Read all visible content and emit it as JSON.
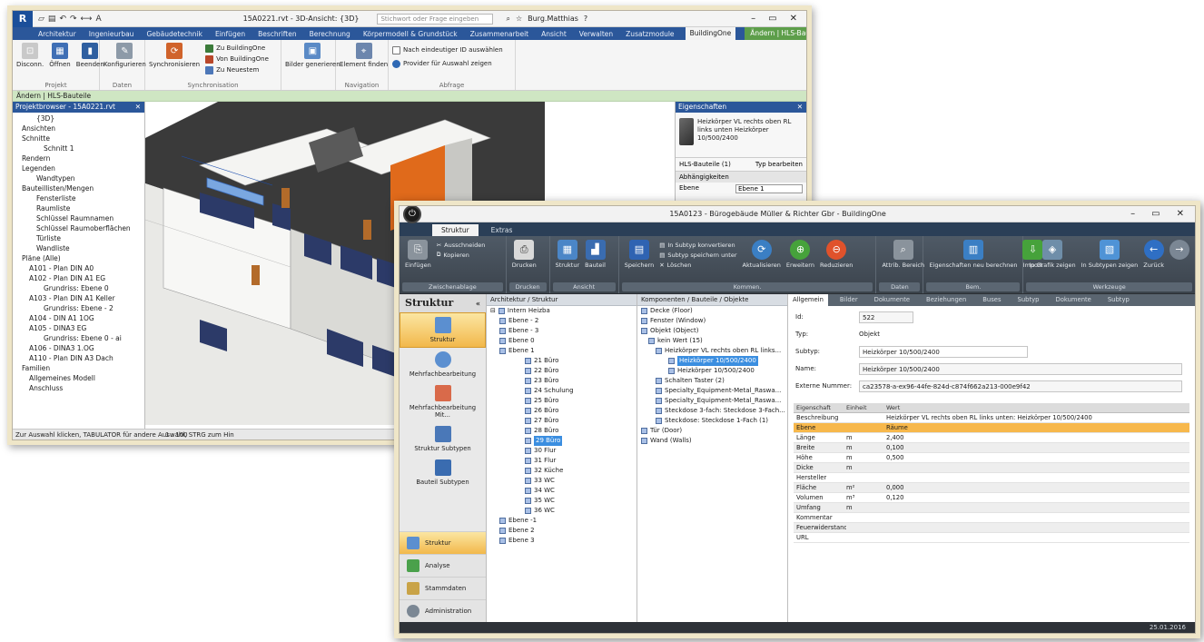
{
  "revit": {
    "title_logo": "R",
    "doc_title": "15A0221.rvt - 3D-Ansicht: {3D}",
    "search_placeholder": "Stichwort oder Frage eingeben",
    "user": "Burg.Matthias",
    "tabs": [
      "Architektur",
      "Ingenieurbau",
      "Gebäudetechnik",
      "Einfügen",
      "Beschriften",
      "Berechnung",
      "Körpermodell & Grundstück",
      "Zusammenarbeit",
      "Ansicht",
      "Verwalten",
      "Zusatzmodule",
      "BuildingOne",
      "Ändern | HLS-Bauteile"
    ],
    "active_tab": "BuildingOne",
    "ribbon": {
      "projekt": {
        "label": "Projekt",
        "buttons": [
          "Disconn.",
          "Öffnen",
          "Beenden"
        ]
      },
      "daten": {
        "label": "Daten",
        "buttons": [
          "Konfigurieren"
        ]
      },
      "sync": {
        "label": "Synchronisation",
        "buttons": [
          "Synchronisieren"
        ],
        "small": [
          "Zu BuildingOne",
          "Von BuildingOne",
          "Zu Neuestem"
        ]
      },
      "bilder": {
        "buttons": [
          "Bilder generieren"
        ]
      },
      "navigation": {
        "label": "Navigation",
        "buttons": [
          "Element finden"
        ]
      },
      "abfrage": {
        "label": "Abfrage",
        "small": [
          "Nach eindeutiger ID auswählen",
          "Provider für Auswahl zeigen"
        ]
      }
    },
    "context_bar": "Ändern | HLS-Bauteile",
    "project_browser": {
      "title": "Projektbrowser - 15A0221.rvt",
      "items": [
        "{3D}",
        "Ansichten",
        "Schnitte",
        "Schnitt 1",
        "Rendern",
        "Legenden",
        "Wandtypen",
        "Bauteillisten/Mengen",
        "Fensterliste",
        "Raumliste",
        "Schlüssel Raumnamen",
        "Schlüssel Raumoberflächen",
        "Türliste",
        "Wandliste",
        "Pläne (Alle)",
        "A101 - Plan DIN A0",
        "A102 - Plan DIN A1 EG",
        "Grundriss: Ebene 0",
        "A103 - Plan DIN A1 Keller",
        "Grundriss: Ebene - 2",
        "A104 - DIN A1 1OG",
        "A105 - DINA3 EG",
        "Grundriss: Ebene 0 - ai",
        "A106 - DINA3 1.OG",
        "A110 - Plan DIN A3 Dach",
        "Familien",
        "Allgemeines Modell",
        "Anschluss"
      ]
    },
    "properties": {
      "title": "Eigenschaften",
      "type_name": "Heizkörper VL rechts oben RL links unten Heizkörper 10/500/2400",
      "filter": "HLS-Bauteile (1)",
      "edit_type": "Typ bearbeiten",
      "section": "Abhängigkeiten",
      "row_label": "Ebene",
      "row_value": "Ebene 1"
    },
    "view_scale": "1 : 100",
    "status": "Zur Auswahl klicken, TABULATOR für andere Auswahl, STRG zum Hin"
  },
  "buildingone": {
    "doc_title": "15A0123 - Bürogebäude Müller & Richter Gbr - BuildingOne",
    "tabs": [
      "Struktur",
      "Extras"
    ],
    "ribbon_groups": [
      {
        "label": "Zwischenablage",
        "buttons": [
          "Einfügen"
        ],
        "small": [
          "Ausschneiden",
          "Kopieren"
        ]
      },
      {
        "label": "Drucken",
        "buttons": [
          "Drucken"
        ]
      },
      {
        "label": "Ansicht",
        "buttons": [
          "Struktur",
          "Bauteil"
        ]
      },
      {
        "label": "Kommen.",
        "buttons": [
          "Speichern",
          "Aktualisieren",
          "Erweitern",
          "Reduzieren"
        ],
        "small": [
          "In Subtyp konvertieren",
          "Subtyp speichern unter",
          "Löschen"
        ]
      },
      {
        "label": "Daten",
        "buttons": [
          "Attrib. Bereich"
        ]
      },
      {
        "label": "Bem.",
        "buttons": [
          "Eigenschaften neu berechnen",
          "Import"
        ]
      },
      {
        "label": "Werkzeuge",
        "buttons": [
          "In Grafik zeigen",
          "In Subtypen zeigen",
          "Zurück"
        ]
      }
    ],
    "left_nav": {
      "title": "Struktur",
      "items": [
        "Struktur",
        "Mehrfachbearbeitung",
        "Mehrfachbearbeitung Mit...",
        "Struktur Subtypen",
        "Bauteil Subtypen"
      ],
      "bottom": [
        "Struktur",
        "Analyse",
        "Stammdaten",
        "Administration"
      ]
    },
    "struct_pane": {
      "title": "Architektur / Struktur",
      "root": "Intern Heizba",
      "items": [
        "Ebene - 2",
        "Ebene - 3",
        "Ebene 0",
        "Ebene 1",
        "21 Büro",
        "22 Büro",
        "23 Büro",
        "24 Schulung",
        "25 Büro",
        "26 Büro",
        "27 Büro",
        "28 Büro",
        "29 Büro",
        "30 Flur",
        "31 Flur",
        "32 Küche",
        "33 WC",
        "34 WC",
        "35 WC",
        "36 WC",
        "Ebene -1",
        "Ebene 2",
        "Ebene 3"
      ],
      "selected": "29 Büro"
    },
    "comp_pane": {
      "title": "Komponenten / Bauteile / Objekte",
      "items": [
        "Decke (Floor)",
        "Fenster (Window)",
        "Objekt (Object)",
        "kein Wert (15)",
        "Heizkörper VL rechts oben RL links...",
        "Heizkörper 10/500/2400",
        "Heizkörper 10/500/2400",
        "Schalten Taster (2)",
        "Specialty_Equipment-Metal_Raswa...",
        "Specialty_Equipment-Metal_Raswa...",
        "Steckdose 3-fach: Steckdose 3-Fach...",
        "Steckdose: Steckdose 1-Fach (1)",
        "Tür (Door)",
        "Wand (Walls)"
      ],
      "selected": "Heizkörper 10/500/2400"
    },
    "detail": {
      "tabs": [
        "Allgemein",
        "Bilder",
        "Dokumente",
        "Beziehungen",
        "Buses",
        "Subtyp",
        "Dokumente",
        "Subtyp"
      ],
      "id_label": "Id:",
      "id_value": "522",
      "typ_label": "Typ:",
      "typ_value": "Objekt",
      "subtyp_label": "Subtyp:",
      "subtyp_value": "Heizkörper 10/500/2400",
      "name_label": "Name:",
      "name_value": "Heizkörper 10/500/2400",
      "ext_label": "Externe Nummer:",
      "ext_value": "ca23578-a-ex96-44fe-824d-c874f662a213-000e9f42",
      "grid_headers": [
        "Eigenschaft",
        "Einheit",
        "Wert"
      ],
      "rows": [
        {
          "name": "Beschreibung",
          "unit": "",
          "value": "Heizkörper VL rechts oben RL links unten: Heizkörper 10/500/2400"
        },
        {
          "name": "Ebene",
          "unit": "",
          "value": "Räume"
        },
        {
          "name": "Länge",
          "unit": "m",
          "value": "2,400"
        },
        {
          "name": "Breite",
          "unit": "m",
          "value": "0,100"
        },
        {
          "name": "Höhe",
          "unit": "m",
          "value": "0,500"
        },
        {
          "name": "Dicke",
          "unit": "m",
          "value": ""
        },
        {
          "name": "Hersteller",
          "unit": "",
          "value": ""
        },
        {
          "name": "Fläche",
          "unit": "m²",
          "value": "0,000"
        },
        {
          "name": "Volumen",
          "unit": "m³",
          "value": "0,120"
        },
        {
          "name": "Umfang",
          "unit": "m",
          "value": ""
        },
        {
          "name": "Kommentar",
          "unit": "",
          "value": ""
        },
        {
          "name": "Feuerwiderstand",
          "unit": "",
          "value": ""
        },
        {
          "name": "URL",
          "unit": "",
          "value": ""
        }
      ],
      "highlight_row": "Ebene"
    },
    "status": "25.01.2016"
  },
  "colors": {
    "revit_tab_bar": "#2b579a",
    "hls_tab": "#5d9e4a",
    "frame_beige": "#efe6c8",
    "b1_ribbon": "#3f4852",
    "selection_orange": "#f7b84c",
    "accent_orange": "#e06a1b"
  }
}
